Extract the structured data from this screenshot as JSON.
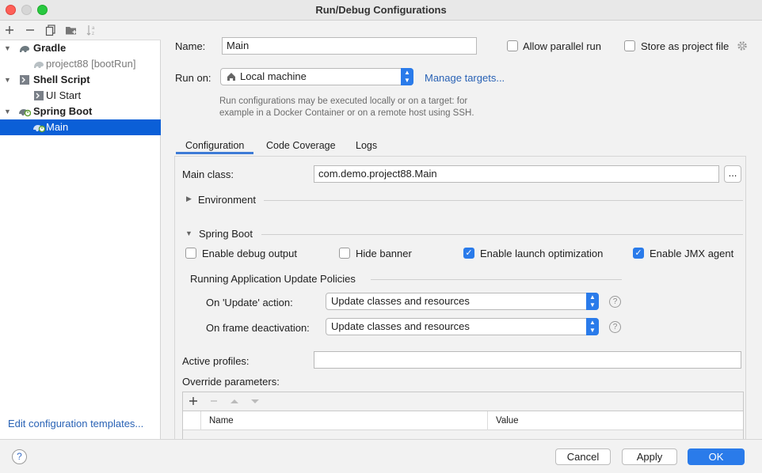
{
  "window": {
    "title": "Run/Debug Configurations"
  },
  "left_toolbar": {
    "icons": [
      "add-icon",
      "remove-icon",
      "copy-icon",
      "new-folder-icon",
      "sort-icon"
    ]
  },
  "tree": [
    {
      "label": "Gradle",
      "type": "group",
      "icon": "gradle-icon"
    },
    {
      "label": "project88 [bootRun]",
      "type": "item",
      "icon": "gradle-icon"
    },
    {
      "label": "Shell Script",
      "type": "group",
      "icon": "shell-script-icon"
    },
    {
      "label": "UI Start",
      "type": "item",
      "icon": "shell-script-icon"
    },
    {
      "label": "Spring Boot",
      "type": "group",
      "icon": "spring-boot-icon"
    },
    {
      "label": "Main",
      "type": "item",
      "icon": "spring-boot-icon",
      "selected": true
    }
  ],
  "edit_templates_link": "Edit configuration templates...",
  "form": {
    "name_label": "Name:",
    "name_value": "Main",
    "allow_parallel_label": "Allow parallel run",
    "store_as_project_label": "Store as project file",
    "run_on_label": "Run on:",
    "run_on_value": "Local machine",
    "manage_targets": "Manage targets...",
    "hint_line1": "Run configurations may be executed locally or on a target: for",
    "hint_line2": "example in a Docker Container or on a remote host using SSH."
  },
  "tabs": [
    {
      "label": "Configuration",
      "active": true
    },
    {
      "label": "Code Coverage",
      "active": false
    },
    {
      "label": "Logs",
      "active": false
    }
  ],
  "config": {
    "main_class_label": "Main class:",
    "main_class_value": "com.demo.project88.Main",
    "browse_label": "...",
    "environment_label": "Environment",
    "spring_boot_label": "Spring Boot",
    "checkboxes": [
      {
        "label": "Enable debug output",
        "checked": false
      },
      {
        "label": "Hide banner",
        "checked": false
      },
      {
        "label": "Enable launch optimization",
        "checked": true
      },
      {
        "label": "Enable JMX agent",
        "checked": true
      }
    ],
    "update_policies_label": "Running Application Update Policies",
    "on_update_label": "On 'Update' action:",
    "on_update_value": "Update classes and resources",
    "on_frame_label": "On frame deactivation:",
    "on_frame_value": "Update classes and resources",
    "active_profiles_label": "Active profiles:",
    "active_profiles_value": "",
    "override_label": "Override parameters:",
    "table_columns": [
      "Name",
      "Value"
    ]
  },
  "buttons": {
    "help": "?",
    "cancel": "Cancel",
    "apply": "Apply",
    "ok": "OK"
  },
  "colors": {
    "accent": "#2a7bea",
    "selection": "#0b5fd7",
    "link": "#2962b5"
  }
}
